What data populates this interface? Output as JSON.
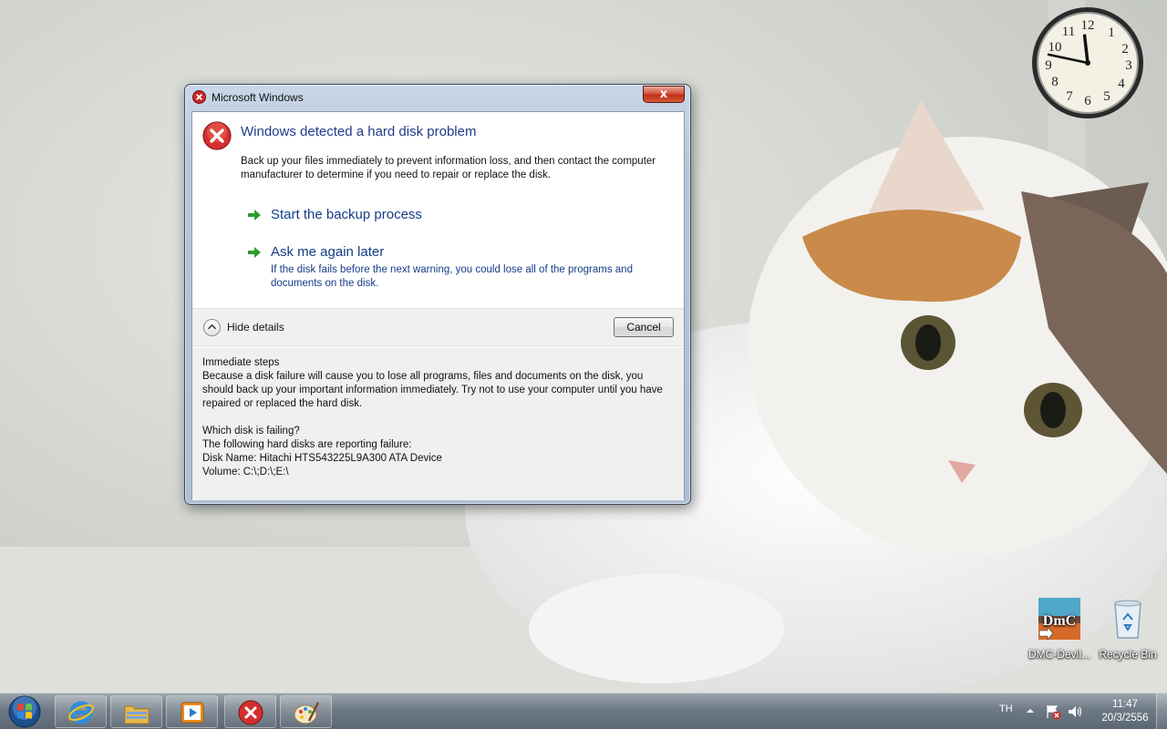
{
  "dialog": {
    "title": "Microsoft Windows",
    "close_label": "x",
    "heading": "Windows detected a hard disk problem",
    "description": "Back up your files immediately to prevent information loss, and then contact the computer manufacturer to determine if you need to repair or replace the disk.",
    "commands": [
      {
        "label": "Start the backup process",
        "sub": ""
      },
      {
        "label": "Ask me again later",
        "sub": "If the disk fails before the next warning, you could lose all of the programs and documents on the disk."
      }
    ],
    "hide_details_label": "Hide details",
    "cancel_label": "Cancel",
    "details": {
      "section1_title": "Immediate steps",
      "section1_body": "Because a disk failure will cause you to lose all programs, files and documents on the disk, you should back up your important information immediately.  Try not to use your computer until you have repaired or replaced the hard disk.",
      "section2_title": "Which disk is failing?",
      "section2_line1": "The following hard disks are reporting failure:",
      "disk_name": "Disk Name: Hitachi HTS543225L9A300 ATA Device",
      "volume": "Volume: C:\\;D:\\;E:\\"
    }
  },
  "desktop_icons": [
    {
      "label": "DMC-Devil...",
      "icon": "dmc-game-icon"
    },
    {
      "label": "Recycle Bin",
      "icon": "recycle-bin-icon"
    }
  ],
  "clock_gadget": {
    "hour": 11,
    "minute": 47
  },
  "taskbar": {
    "buttons": [
      "start-orb-icon",
      "internet-explorer-icon",
      "windows-explorer-icon",
      "media-player-icon",
      "error-window-icon",
      "paint-icon"
    ],
    "language": "TH",
    "time": "11:47",
    "date": "20/3/2556"
  },
  "colors": {
    "heading_blue": "#1f3a8a",
    "link_blue": "#153c87",
    "error_red": "#c62828",
    "arrow_green": "#2e9b2e"
  }
}
